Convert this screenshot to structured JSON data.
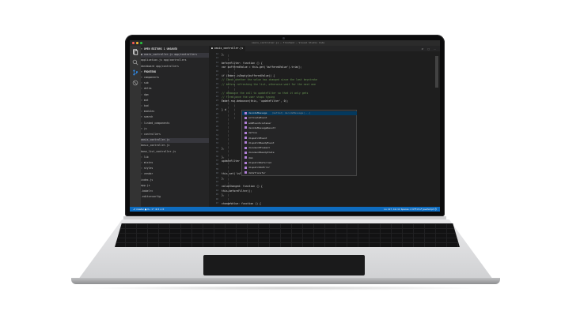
{
  "window": {
    "title": "oasis_controller.js — frontend — Visual Studio Code"
  },
  "activity_bar": {
    "icons": [
      "explorer-icon",
      "search-icon",
      "source-control-icon",
      "debug-icon"
    ]
  },
  "explorer": {
    "header": "OPEN EDITORS",
    "items": [
      {
        "label": "▾ OPEN EDITORS  1 UNSAVED",
        "hdr": true
      },
      {
        "label": "  ● oasis_controller.js  app/controllers",
        "sel": true
      },
      {
        "label": "    application.js  app/controllers"
      },
      {
        "label": "    dashboard  app/controllers"
      },
      {
        "label": "▾ FRONTEND",
        "hdr": true
      },
      {
        "label": "  ▾ components"
      },
      {
        "label": "    › sub"
      },
      {
        "label": "    › delta"
      },
      {
        "label": "    › dpm"
      },
      {
        "label": "    › mat"
      },
      {
        "label": "    › bud"
      },
      {
        "label": "    › modules"
      },
      {
        "label": "    ▾ search"
      },
      {
        "label": "      › linked_components"
      },
      {
        "label": "        ▾ js"
      },
      {
        "label": "          ▾ controllers"
      },
      {
        "label": "              oasis_controller.js",
        "sel": true
      },
      {
        "label": "              basic_controller.js"
      },
      {
        "label": "              base_list_controller.js"
      },
      {
        "label": "        › lib"
      },
      {
        "label": "        › mixins"
      },
      {
        "label": "        › styles"
      },
      {
        "label": "        › vendor"
      },
      {
        "label": "          index.js"
      },
      {
        "label": "          app.js"
      },
      {
        "label": "    .babelrc"
      },
      {
        "label": "    .editorconfig"
      }
    ]
  },
  "editor": {
    "tab": "● oasis_controller.js",
    "tab_icons": "⇄ ▢ ⋯",
    "lines": [
      {
        "t": "      },"
      },
      {
        "t": ""
      },
      {
        "t": "      beforeFilter: function () {"
      },
      {
        "t": "        var bufferedValue = this.get('bufferedValue').trim();"
      },
      {
        "t": ""
      },
      {
        "t": "        if (Ember.isEmpty(bufferedValue)) {"
      },
      {
        "t": "          // Check whether the value has changed since the last keystroke"
      },
      {
        "t": "          // before refreshing the list, otherwise wait for the next one"
      },
      {
        "t": ""
      },
      {
        "t": "          // debounce the call to updateFilter so that it only gets"
      },
      {
        "t": "          // fired once the user stops typing"
      },
      {
        "t": "          Ember.run.debounce(this, 'updateFilter', 0);"
      },
      {
        "t": ""
      },
      {
        "t": "        } d"
      },
      {
        "t": ""
      },
      {
        "t": ""
      },
      {
        "t": ""
      },
      {
        "t": ""
      },
      {
        "t": ""
      },
      {
        "t": ""
      },
      {
        "t": ""
      },
      {
        "t": ""
      },
      {
        "t": "        },"
      },
      {
        "t": ""
      },
      {
        "t": "      },"
      },
      {
        "t": "      updateFilter"
      },
      {
        "t": ""
      },
      {
        "t": ""
      },
      {
        "t": "        this.set('isFiltering', false);"
      },
      {
        "t": "      },"
      },
      {
        "t": ""
      },
      {
        "t": "      valueChanged: function () {"
      },
      {
        "t": "        this.beforeFilter();"
      },
      {
        "t": "      },"
      },
      {
        "t": ""
      },
      {
        "t": "      changeValue: function () {"
      }
    ],
    "line_numbers": [
      "12",
      "13",
      "14",
      "15",
      "16",
      "17",
      "18",
      "19",
      "20",
      "21",
      "22",
      "23",
      "24",
      "25",
      "26",
      "27",
      "28",
      "29",
      "30",
      "31",
      "32",
      "33",
      "34",
      "35",
      "36",
      "37",
      "38",
      "39",
      "40",
      "41",
      "42",
      "43",
      "44",
      "45",
      "46",
      "47"
    ]
  },
  "suggest": {
    "items": [
      {
        "label": "decodeMessage",
        "hint": "(method) decodeMessage(...)",
        "sel": true
      },
      {
        "label": "activateEvent"
      },
      {
        "label": "addEventListener"
      },
      {
        "label": "decodeMessageResult"
      },
      {
        "label": "define"
      },
      {
        "label": "dispatchEvent"
      },
      {
        "label": "dispatchReadyEvent"
      },
      {
        "label": "documentElement"
      },
      {
        "label": "documentReadyState"
      },
      {
        "label": "dom"
      },
      {
        "label": "dispatchDeferred"
      },
      {
        "label": "dispatchOnError"
      },
      {
        "label": "dataTransfer"
      }
    ]
  },
  "status_bar": {
    "left": "⎇ master ● 0⇣ 1⇡   ⊗ 0  ⚠ 0",
    "right": "Ln 117, Col 11   Spaces: 2   UTF-8   LF   JavaScript   ☺"
  },
  "colors": {
    "status": "#0e6cbf",
    "editor_bg": "#1e1e1e",
    "sidebar_bg": "#252526"
  }
}
